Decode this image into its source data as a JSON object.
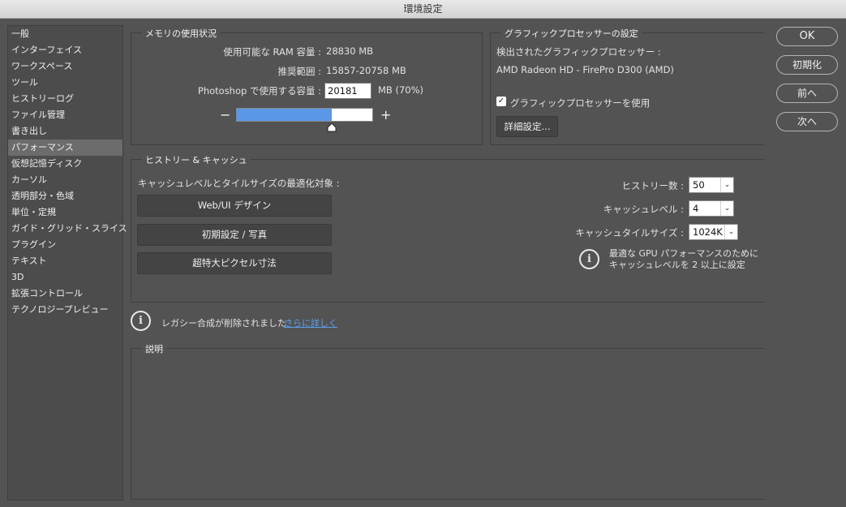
{
  "window": {
    "title": "環境設定"
  },
  "sidebar": {
    "items": [
      {
        "label": "一般"
      },
      {
        "label": "インターフェイス"
      },
      {
        "label": "ワークスペース"
      },
      {
        "label": "ツール"
      },
      {
        "label": "ヒストリーログ"
      },
      {
        "label": "ファイル管理"
      },
      {
        "label": "書き出し"
      },
      {
        "label": "パフォーマンス",
        "active": true
      },
      {
        "label": "仮想記憶ディスク"
      },
      {
        "label": "カーソル"
      },
      {
        "label": "透明部分・色域"
      },
      {
        "label": "単位・定規"
      },
      {
        "label": "ガイド・グリッド・スライス"
      },
      {
        "label": "プラグイン"
      },
      {
        "label": "テキスト"
      },
      {
        "label": "3D"
      },
      {
        "label": "拡張コントロール"
      },
      {
        "label": "テクノロジープレビュー"
      }
    ]
  },
  "memory": {
    "title": "メモリの使用状況",
    "available_label": "使用可能な RAM 容量 :",
    "available_value": "28830 MB",
    "range_label": "推奨範囲 :",
    "range_value": "15857-20758 MB",
    "use_label": "Photoshop で使用する容量 :",
    "use_value": "20181",
    "use_suffix": "MB (70%)",
    "minus": "−",
    "plus": "+",
    "slider_fraction": 0.7
  },
  "gpu": {
    "title": "グラフィックプロセッサーの設定",
    "detected_label": "検出されたグラフィックプロセッサー :",
    "detected_value": "AMD Radeon HD - FirePro D300 (AMD)",
    "use_gpu_label": "グラフィックプロセッサーを使用",
    "use_gpu_checked": true,
    "advanced_button": "詳細設定..."
  },
  "history_cache": {
    "title": "ヒストリー & キャッシュ",
    "optimize_label": "キャッシュレベルとタイルサイズの最適化対象 :",
    "presets": [
      "Web/UI デザイン",
      "初期設定 / 写真",
      "超特大ピクセル寸法"
    ],
    "history_states_label": "ヒストリー数 :",
    "history_states_value": "50",
    "cache_levels_label": "キャッシュレベル :",
    "cache_levels_value": "4",
    "cache_tile_label": "キャッシュタイルサイズ :",
    "cache_tile_value": "1024K",
    "tip_line1": "最適な GPU パフォーマンスのために",
    "tip_line2": "キャッシュレベルを 2 以上に設定"
  },
  "legacy": {
    "message": "レガシー合成が削除されました",
    "link": "さらに詳しく"
  },
  "description": {
    "title": "説明"
  },
  "buttons": {
    "ok": "OK",
    "reset": "初期化",
    "prev": "前へ",
    "next": "次へ"
  },
  "colors": {
    "background": "#535353",
    "slider_fill": "#5a97e6",
    "link": "#5aa0f0"
  }
}
